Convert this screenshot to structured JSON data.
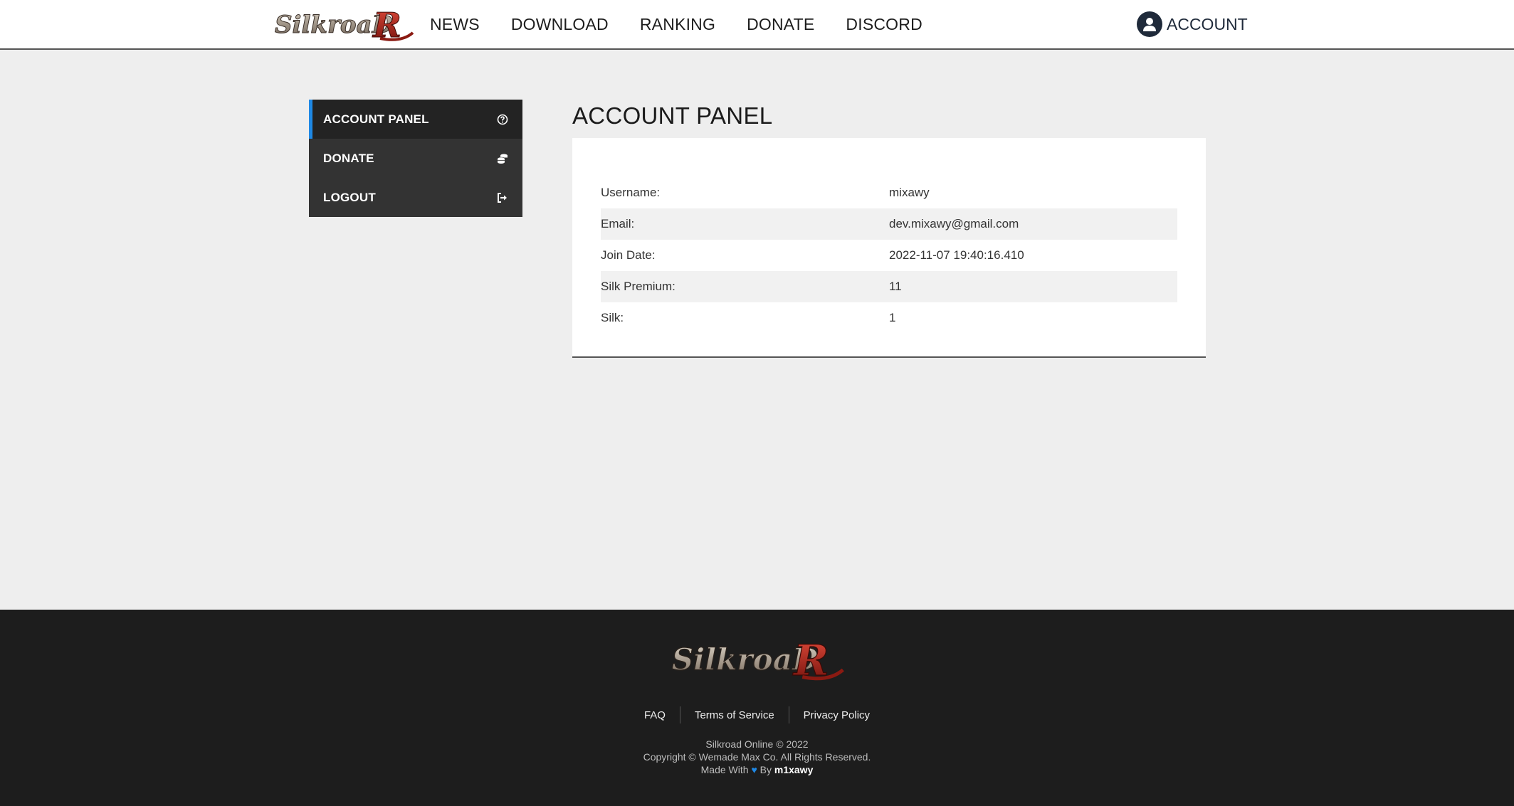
{
  "header": {
    "logo_text": "SilkroadR",
    "nav": [
      {
        "label": "NEWS"
      },
      {
        "label": "DOWNLOAD"
      },
      {
        "label": "RANKING"
      },
      {
        "label": "DONATE"
      },
      {
        "label": "DISCORD"
      }
    ],
    "account_label": "ACCOUNT"
  },
  "sidebar": {
    "items": [
      {
        "label": "ACCOUNT PANEL",
        "icon": "question-circle-icon"
      },
      {
        "label": "DONATE",
        "icon": "coins-icon"
      },
      {
        "label": "LOGOUT",
        "icon": "sign-out-icon"
      }
    ]
  },
  "panel": {
    "title": "ACCOUNT PANEL",
    "rows": [
      {
        "key": "Username:",
        "value": "mixawy"
      },
      {
        "key": "Email:",
        "value": "dev.mixawy@gmail.com"
      },
      {
        "key": "Join Date:",
        "value": "2022-11-07 19:40:16.410"
      },
      {
        "key": "Silk Premium:",
        "value": "11"
      },
      {
        "key": "Silk:",
        "value": "1"
      }
    ]
  },
  "footer": {
    "logo_text": "SilkroadR",
    "links": [
      {
        "label": "FAQ"
      },
      {
        "label": "Terms of Service"
      },
      {
        "label": "Privacy Policy"
      }
    ],
    "line1": "Silkroad Online © 2022",
    "line2": "Copyright © Wemade Max Co. All Rights Reserved.",
    "made_with": "Made With",
    "by": "By",
    "author": "m1xawy"
  },
  "colors": {
    "accent": "#1e88e5",
    "sidebar_bg": "#333333",
    "footer_bg": "#1d1d1d",
    "page_bg": "#eeeeee"
  }
}
